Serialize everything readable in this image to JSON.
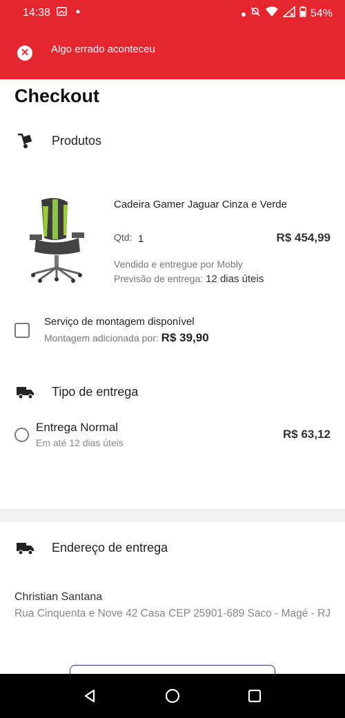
{
  "status_bar": {
    "time": "14:38",
    "battery": "54%"
  },
  "error": {
    "message": "Algo errado aconteceu"
  },
  "page": {
    "title": "Checkout"
  },
  "products_section": {
    "title": "Produtos"
  },
  "product": {
    "name": "Cadeira Gamer Jaguar Cinza e Verde",
    "qty_label": "Qtd:",
    "qty_value": "1",
    "price": "R$ 454,99",
    "sold_by": "Vendido e entregue por Mobly",
    "delivery_label": "Previsão de entrega:",
    "delivery_value": "12 dias úteis"
  },
  "assembly": {
    "title": "Serviço de montagem disponível",
    "subtitle_label": "Montagem adicionada por:",
    "price": "R$ 39,90"
  },
  "delivery_section": {
    "title": "Tipo de entrega"
  },
  "delivery_option": {
    "name": "Entrega Normal",
    "subtitle": "Em até 12 dias úteis",
    "price": "R$ 63,12"
  },
  "address_section": {
    "title": "Endereço de entrega"
  },
  "address": {
    "name": "Christian Santana",
    "line": "Rua Cinquenta e Nove 42 Casa  CEP 25901-689 Saco - Magé - RJ"
  },
  "colors": {
    "error": "#e5262f",
    "accent_border": "#4b2a6b"
  },
  "icons": {
    "error": "close-circle-icon",
    "products": "hand-truck-icon",
    "delivery": "truck-icon",
    "address": "truck-icon"
  }
}
